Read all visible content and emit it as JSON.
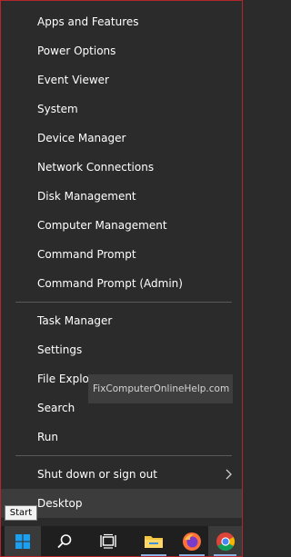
{
  "menu": {
    "items": [
      {
        "label": "Apps and Features"
      },
      {
        "label": "Power Options"
      },
      {
        "label": "Event Viewer"
      },
      {
        "label": "System"
      },
      {
        "label": "Device Manager"
      },
      {
        "label": "Network Connections"
      },
      {
        "label": "Disk Management"
      },
      {
        "label": "Computer Management"
      },
      {
        "label": "Command Prompt"
      },
      {
        "label": "Command Prompt (Admin)"
      },
      {
        "label": "Task Manager"
      },
      {
        "label": "Settings"
      },
      {
        "label": "File Explorer"
      },
      {
        "label": "Search"
      },
      {
        "label": "Run"
      },
      {
        "label": "Shut down or sign out"
      },
      {
        "label": "Desktop"
      }
    ]
  },
  "watermark": "FixComputerOnlineHelp.com",
  "tooltip": "Start",
  "taskbar": {
    "icons": [
      "windows-start-icon",
      "search-icon",
      "task-view-icon",
      "file-explorer-icon",
      "firefox-icon",
      "chrome-icon"
    ],
    "colors": {
      "start": "#1a9ff2",
      "chrome_red": "#db4437",
      "firefox": "#ff7139",
      "folder": "#f4c542"
    }
  }
}
